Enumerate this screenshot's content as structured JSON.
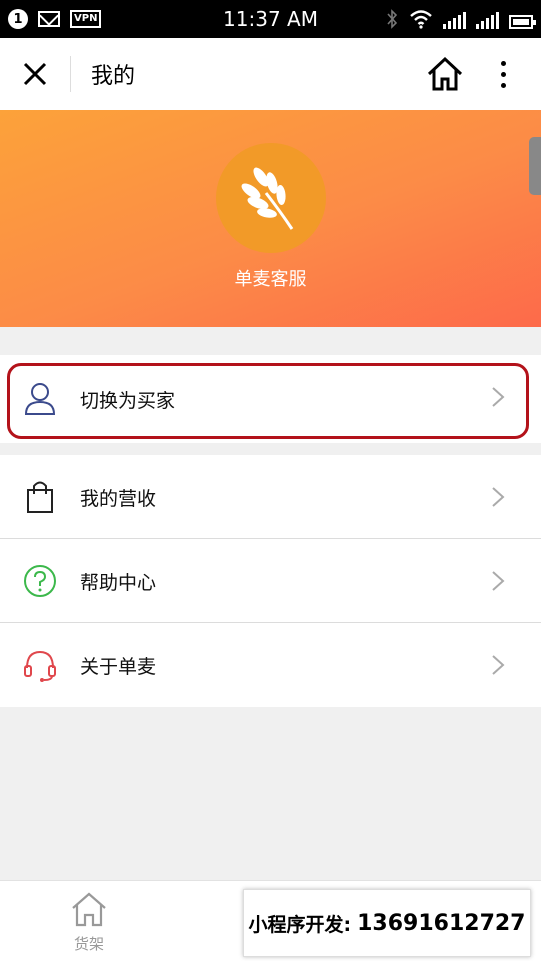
{
  "status_bar": {
    "notification_count": "1",
    "vpn_label": "VPN",
    "time": "11:37 AM",
    "icons": [
      "mail-icon",
      "bluetooth-icon",
      "wifi-icon",
      "signal-icon",
      "battery-icon"
    ]
  },
  "navbar": {
    "title": "我的",
    "icons": [
      "close-icon",
      "home-icon",
      "more-icon"
    ]
  },
  "profile": {
    "name": "单麦客服",
    "avatar_icon": "wheat-icon"
  },
  "menu": {
    "items": [
      {
        "label": "切换为买家",
        "icon": "user-icon"
      },
      {
        "label": "我的营收",
        "icon": "shopping-bag-icon"
      },
      {
        "label": "帮助中心",
        "icon": "help-icon"
      },
      {
        "label": "关于单麦",
        "icon": "headset-icon"
      }
    ]
  },
  "tabbar": {
    "tab_home_label": "货架"
  },
  "promo": {
    "prefix": "小程序开发:",
    "phone": "13691612727"
  },
  "colors": {
    "hero_start": "#fca23a",
    "hero_end": "#fd6a4a",
    "highlight_border": "#b3121a",
    "help_icon": "#3cb84b",
    "headset_icon": "#e0474c",
    "user_icon": "#3b4a8c"
  }
}
